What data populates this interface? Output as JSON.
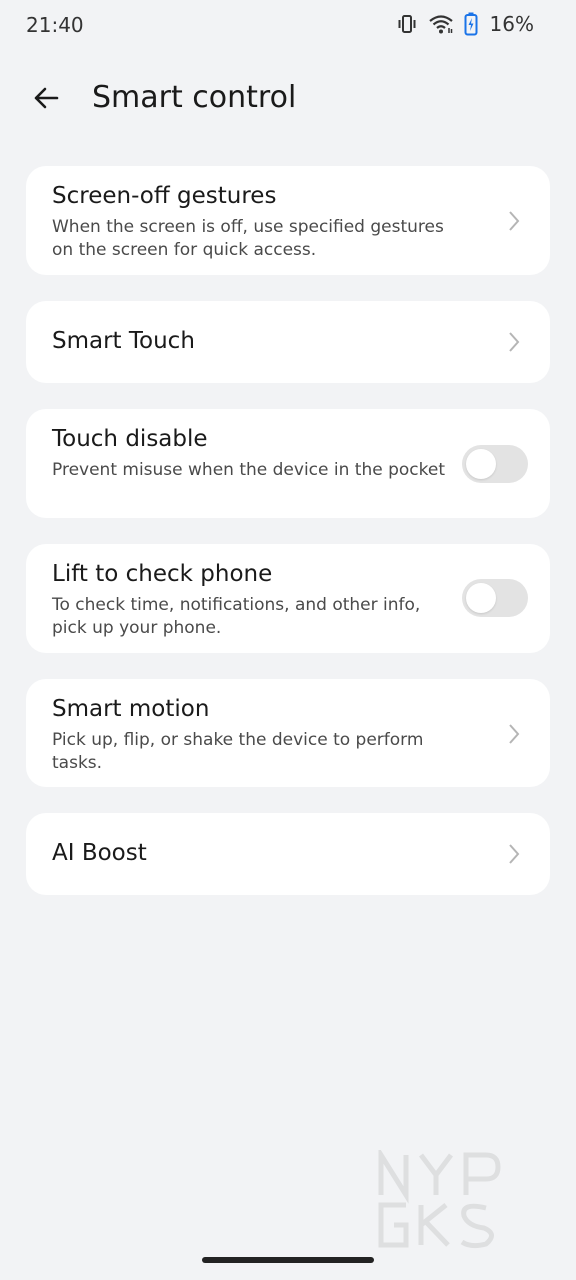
{
  "status_bar": {
    "time": "21:40",
    "battery_percent": "16%",
    "icons": [
      "vibrate-icon",
      "wifi-icon",
      "battery-charging-icon"
    ]
  },
  "header": {
    "back_icon": "arrow-left-icon",
    "title": "Smart control"
  },
  "settings": [
    {
      "title": "Screen-off gestures",
      "subtitle": "When the screen is off, use specified gestures on the screen for quick access.",
      "control": "chevron"
    },
    {
      "title": "Smart Touch",
      "subtitle": "",
      "control": "chevron"
    },
    {
      "title": "Touch disable",
      "subtitle": "Prevent misuse when the device in the pocket",
      "control": "toggle",
      "enabled": false
    },
    {
      "title": "Lift to check phone",
      "subtitle": "To check time, notifications, and other info, pick up your phone.",
      "control": "toggle",
      "enabled": false
    },
    {
      "title": "Smart motion",
      "subtitle": "Pick up, flip, or shake the device to perform tasks.",
      "control": "chevron"
    },
    {
      "title": "AI Boost",
      "subtitle": "",
      "control": "chevron"
    }
  ],
  "colors": {
    "background": "#f2f3f5",
    "card": "#ffffff",
    "toggle_off": "#e3e3e3",
    "battery_accent": "#1a73e8"
  }
}
